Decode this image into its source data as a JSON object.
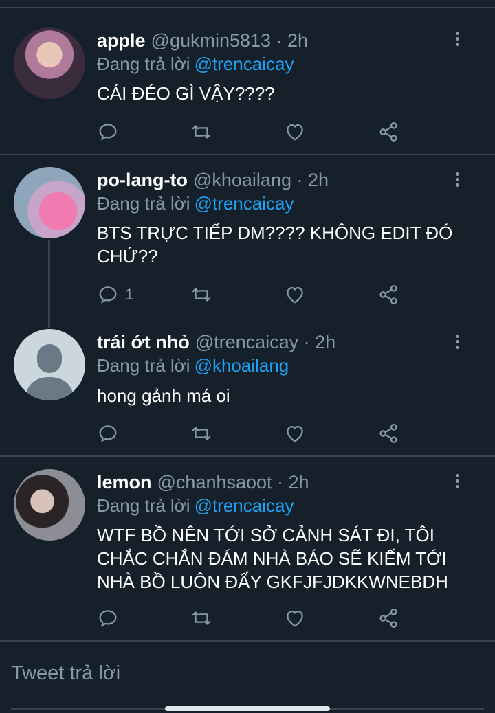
{
  "tweets": [
    {
      "name": "apple",
      "handle": "@gukmin5813 · 2h",
      "reply_prefix": "Đang trả lời",
      "reply_to": "@trencaicay",
      "text": "CÁI ĐÉO GÌ VẬY????",
      "reply_count": ""
    },
    {
      "name": "po-lang-to",
      "handle": "@khoailang · 2h",
      "reply_prefix": "Đang trả lời",
      "reply_to": "@trencaicay",
      "text": "BTS TRỰC TIẾP DM???? KHÔNG EDIT ĐÓ CHỨ??",
      "reply_count": "1"
    },
    {
      "name": "trái ớt nhỏ",
      "handle": "@trencaicay · 2h",
      "reply_prefix": "Đang trả lời",
      "reply_to": "@khoailang",
      "text": "hong gảnh má oi",
      "reply_count": ""
    },
    {
      "name": "lemon",
      "handle": "@chanhsaoot · 2h",
      "reply_prefix": "Đang trả lời",
      "reply_to": "@trencaicay",
      "text": "WTF BỒ NÊN TỚI SỞ CẢNH SÁT ĐI, TÔI CHẮC CHẮN ĐÁM NHÀ BÁO SẼ KIẾM TỚI NHÀ BỒ LUÔN ĐẤY GKFJFJDKKWNEBDH",
      "reply_count": ""
    }
  ],
  "compose": {
    "placeholder": "Tweet trả lời"
  },
  "colors": {
    "background": "#15202b",
    "secondary_text": "#8899a6",
    "accent": "#1da1f2",
    "divider": "#38444d"
  }
}
